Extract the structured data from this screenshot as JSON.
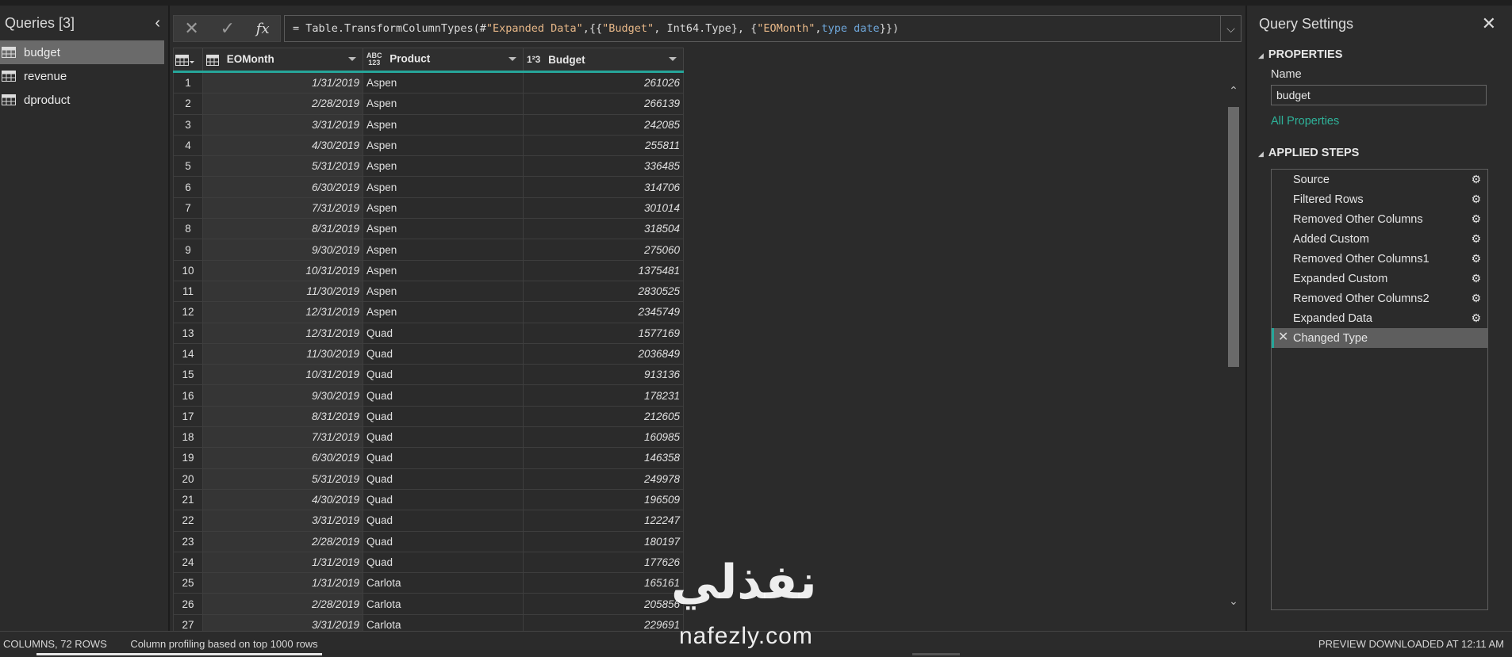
{
  "queries": {
    "title": "Queries [3]",
    "items": [
      {
        "label": "budget",
        "selected": true
      },
      {
        "label": "revenue",
        "selected": false
      },
      {
        "label": "dproduct",
        "selected": false
      }
    ]
  },
  "formula": {
    "p1": "= Table.TransformColumnTypes(#",
    "s1": "\"Expanded Data\"",
    "p2": ",{{",
    "s2": "\"Budget\"",
    "p3": ", Int64.Type}, {",
    "s3": "\"EOMonth\"",
    "p4": ", ",
    "k1": "type date",
    "p5": "}})"
  },
  "grid": {
    "columns": [
      {
        "label": "EOMonth",
        "type_icon": "calendar-table-icon"
      },
      {
        "label": "Product",
        "type_icon": "abc-123-icon"
      },
      {
        "label": "Budget",
        "type_icon": "123-icon"
      }
    ],
    "rows": [
      {
        "n": "1",
        "date": "1/31/2019",
        "product": "Aspen",
        "budget": "261026"
      },
      {
        "n": "2",
        "date": "2/28/2019",
        "product": "Aspen",
        "budget": "266139"
      },
      {
        "n": "3",
        "date": "3/31/2019",
        "product": "Aspen",
        "budget": "242085"
      },
      {
        "n": "4",
        "date": "4/30/2019",
        "product": "Aspen",
        "budget": "255811"
      },
      {
        "n": "5",
        "date": "5/31/2019",
        "product": "Aspen",
        "budget": "336485"
      },
      {
        "n": "6",
        "date": "6/30/2019",
        "product": "Aspen",
        "budget": "314706"
      },
      {
        "n": "7",
        "date": "7/31/2019",
        "product": "Aspen",
        "budget": "301014"
      },
      {
        "n": "8",
        "date": "8/31/2019",
        "product": "Aspen",
        "budget": "318504"
      },
      {
        "n": "9",
        "date": "9/30/2019",
        "product": "Aspen",
        "budget": "275060"
      },
      {
        "n": "10",
        "date": "10/31/2019",
        "product": "Aspen",
        "budget": "1375481"
      },
      {
        "n": "11",
        "date": "11/30/2019",
        "product": "Aspen",
        "budget": "2830525"
      },
      {
        "n": "12",
        "date": "12/31/2019",
        "product": "Aspen",
        "budget": "2345749"
      },
      {
        "n": "13",
        "date": "12/31/2019",
        "product": "Quad",
        "budget": "1577169"
      },
      {
        "n": "14",
        "date": "11/30/2019",
        "product": "Quad",
        "budget": "2036849"
      },
      {
        "n": "15",
        "date": "10/31/2019",
        "product": "Quad",
        "budget": "913136"
      },
      {
        "n": "16",
        "date": "9/30/2019",
        "product": "Quad",
        "budget": "178231"
      },
      {
        "n": "17",
        "date": "8/31/2019",
        "product": "Quad",
        "budget": "212605"
      },
      {
        "n": "18",
        "date": "7/31/2019",
        "product": "Quad",
        "budget": "160985"
      },
      {
        "n": "19",
        "date": "6/30/2019",
        "product": "Quad",
        "budget": "146358"
      },
      {
        "n": "20",
        "date": "5/31/2019",
        "product": "Quad",
        "budget": "249978"
      },
      {
        "n": "21",
        "date": "4/30/2019",
        "product": "Quad",
        "budget": "196509"
      },
      {
        "n": "22",
        "date": "3/31/2019",
        "product": "Quad",
        "budget": "122247"
      },
      {
        "n": "23",
        "date": "2/28/2019",
        "product": "Quad",
        "budget": "180197"
      },
      {
        "n": "24",
        "date": "1/31/2019",
        "product": "Quad",
        "budget": "177626"
      },
      {
        "n": "25",
        "date": "1/31/2019",
        "product": "Carlota",
        "budget": "165161"
      },
      {
        "n": "26",
        "date": "2/28/2019",
        "product": "Carlota",
        "budget": "205856"
      },
      {
        "n": "27",
        "date": "3/31/2019",
        "product": "Carlota",
        "budget": "229691"
      }
    ]
  },
  "settings": {
    "title": "Query Settings",
    "properties_header": "PROPERTIES",
    "name_label": "Name",
    "name_value": "budget",
    "all_properties": "All Properties",
    "steps_header": "APPLIED STEPS",
    "steps": [
      {
        "label": "Source",
        "gear": true,
        "active": false
      },
      {
        "label": "Filtered Rows",
        "gear": true,
        "active": false
      },
      {
        "label": "Removed Other Columns",
        "gear": true,
        "active": false
      },
      {
        "label": "Added Custom",
        "gear": true,
        "active": false
      },
      {
        "label": "Removed Other Columns1",
        "gear": true,
        "active": false
      },
      {
        "label": "Expanded Custom",
        "gear": true,
        "active": false
      },
      {
        "label": "Removed Other Columns2",
        "gear": true,
        "active": false
      },
      {
        "label": "Expanded Data",
        "gear": true,
        "active": false
      },
      {
        "label": "Changed Type",
        "gear": false,
        "active": true
      }
    ]
  },
  "status": {
    "columns_rows": "COLUMNS, 72 ROWS",
    "profiling": "Column profiling based on top 1000 rows",
    "preview": "PREVIEW DOWNLOADED AT 12:11 AM"
  },
  "watermark": {
    "arabic": "نفذلي",
    "latin": "nafezly.com"
  },
  "colors": {
    "accent": "#26a69a",
    "link": "#2eb39a",
    "background": "#2b2b2b"
  }
}
